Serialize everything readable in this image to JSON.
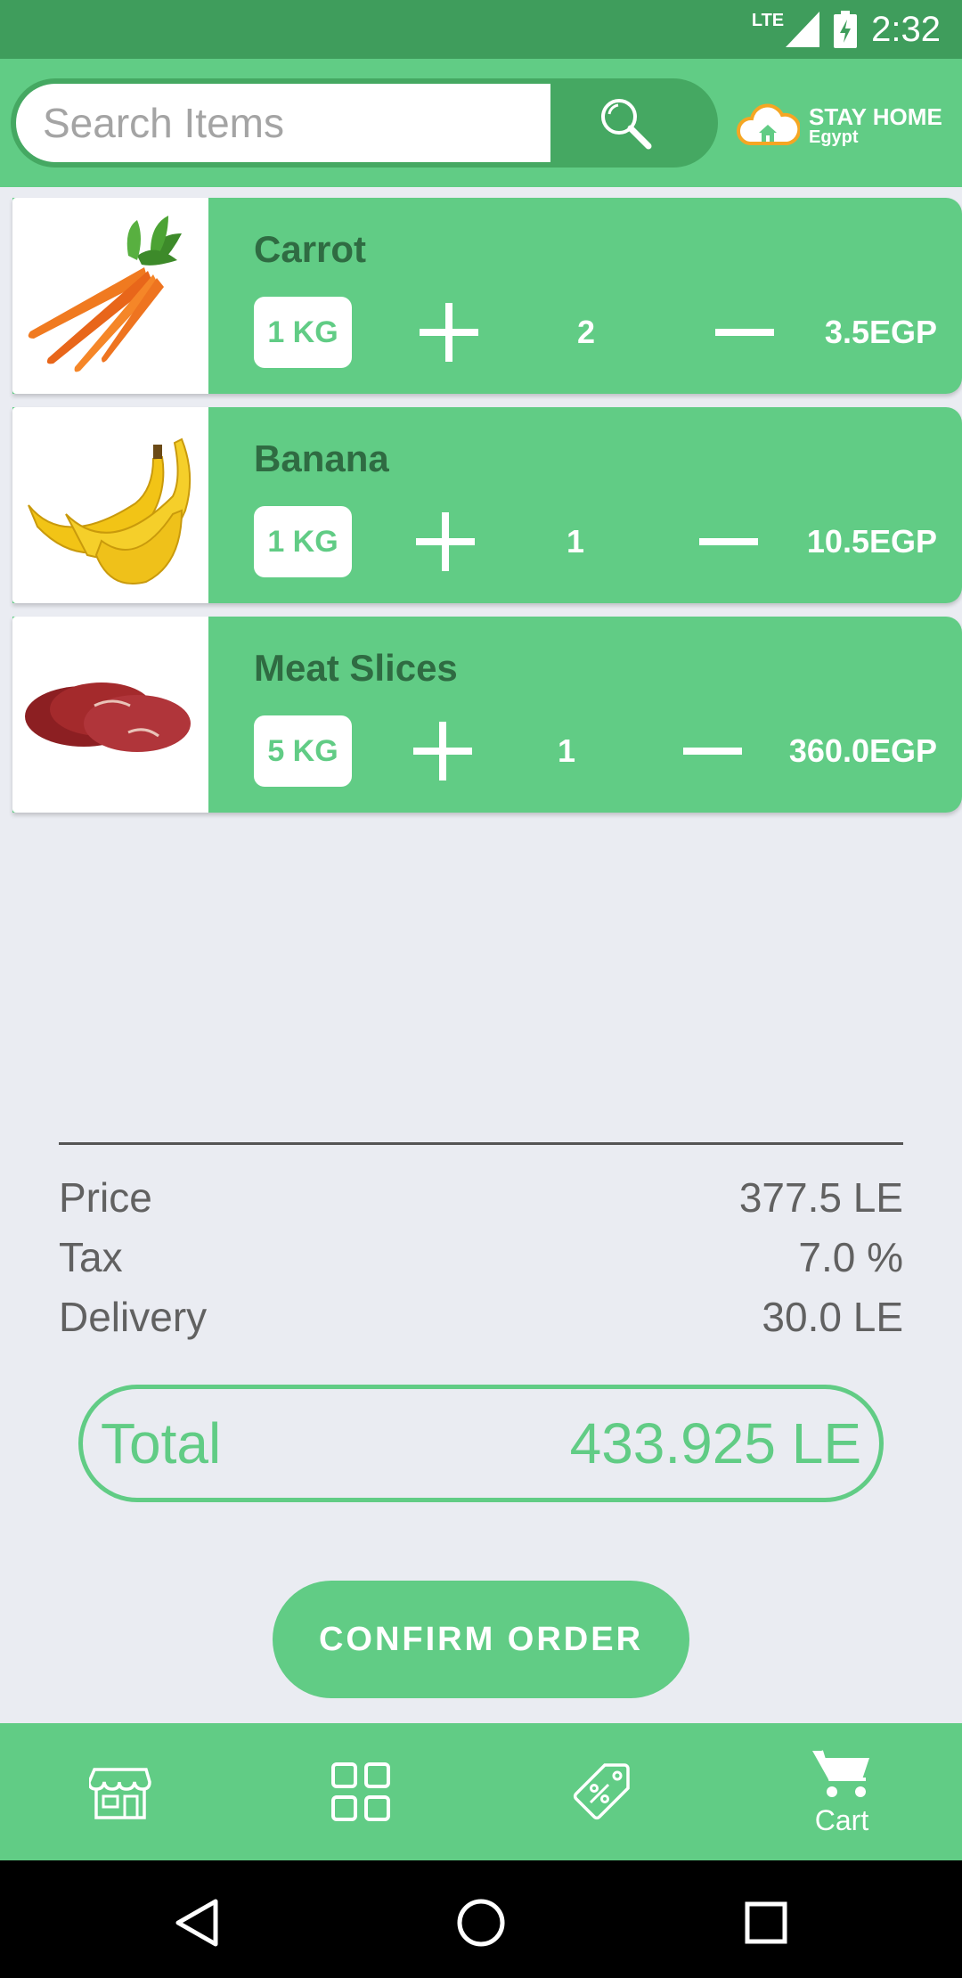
{
  "status_bar": {
    "network": "LTE",
    "time": "2:32"
  },
  "search": {
    "placeholder": "Search Items",
    "icon": "magnifier-icon"
  },
  "logo": {
    "title": "STAY HOME",
    "subtitle": "Egypt"
  },
  "cart": {
    "items": [
      {
        "name": "Carrot",
        "weight": "1 KG",
        "quantity": "2",
        "price": "3.5EGP",
        "image": "carrot"
      },
      {
        "name": "Banana",
        "weight": "1 KG",
        "quantity": "1",
        "price": "10.5EGP",
        "image": "banana"
      },
      {
        "name": "Meat Slices",
        "weight": "5 KG",
        "quantity": "1",
        "price": "360.0EGP",
        "image": "meat"
      }
    ]
  },
  "summary": {
    "price_label": "Price",
    "price_value": "377.5 LE",
    "tax_label": "Tax",
    "tax_value": "7.0 %",
    "delivery_label": "Delivery",
    "delivery_value": "30.0 LE"
  },
  "total": {
    "label": "Total",
    "value": "433.925 LE"
  },
  "confirm_label": "CONFIRM ORDER",
  "bottom_nav": {
    "items": [
      {
        "icon": "store-icon",
        "label": ""
      },
      {
        "icon": "grid-icon",
        "label": ""
      },
      {
        "icon": "tag-icon",
        "label": ""
      },
      {
        "icon": "cart-icon",
        "label": "Cart"
      }
    ]
  },
  "colors": {
    "primary": "#61cc85",
    "primary_dark": "#3f9d5c",
    "background": "#eaecf2",
    "item_title": "#2f6b42"
  }
}
